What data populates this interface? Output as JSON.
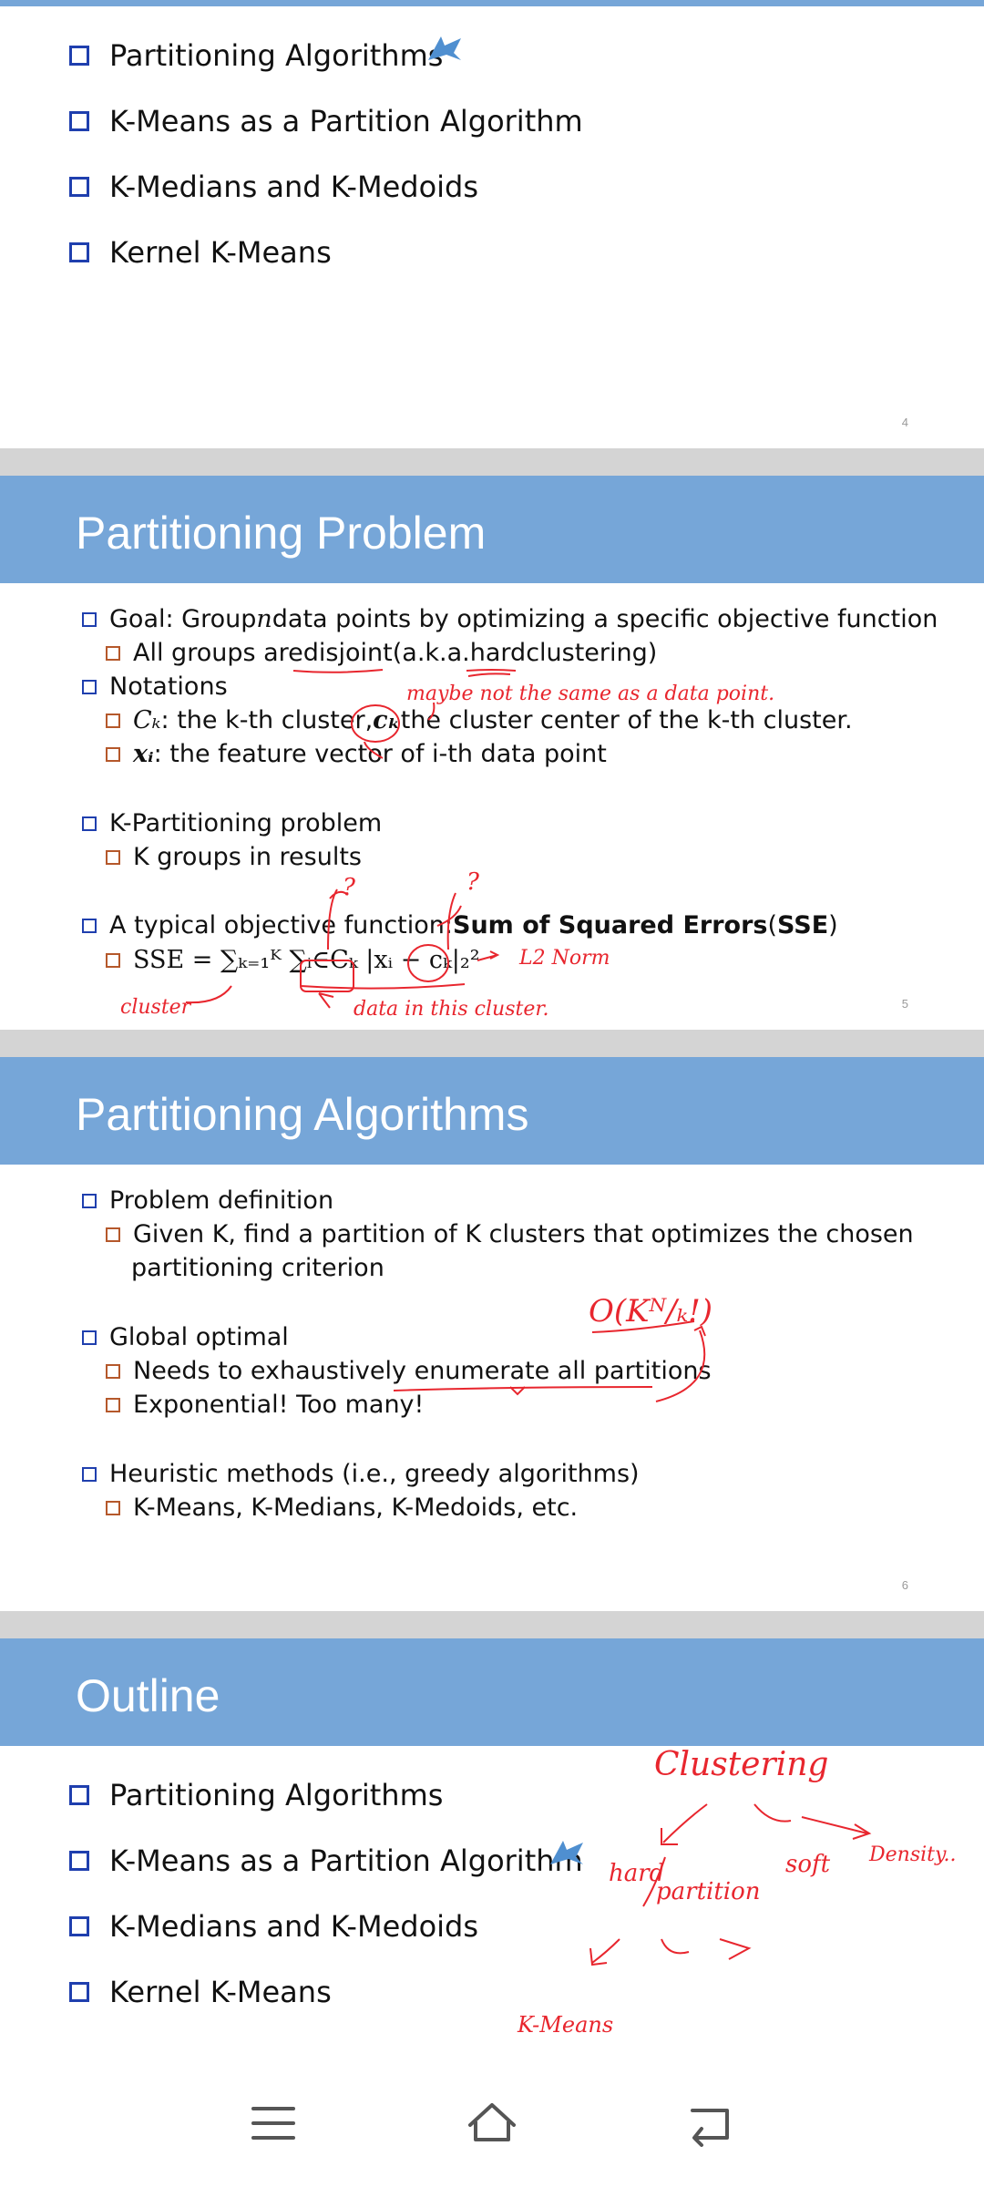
{
  "slides": [
    {
      "page": "4",
      "outline": [
        "Partitioning Algorithms",
        "K-Means as a Partition Algorithm",
        "K-Medians and K-Medoids",
        "Kernel K-Means"
      ]
    },
    {
      "title": "Partitioning Problem",
      "page": "5",
      "goal_pre": "Goal: Group ",
      "goal_n": "n",
      "goal_post": " data points by optimizing a specific objective function",
      "disjoint_pre": "All groups are ",
      "disjoint_word": "disjoint",
      "disjoint_mid": " (a.k.a. ",
      "hard_word": "hard",
      "disjoint_post": " clustering)",
      "notations": "Notations",
      "ck_sym": "Cₖ",
      "ck_text": ": the k-th cluster, ",
      "ck_center_sym": "cₖ",
      "ck_center_text": " the cluster center of the k-th cluster.",
      "xi_sym": "xᵢ",
      "xi_text": ": the feature vector of i-th data point",
      "kpart": "K-Partitioning problem",
      "kgroups": "K groups in results",
      "obj_pre": "A typical objective function: ",
      "obj_bold": "Sum of Squared Errors",
      "obj_mid": " (",
      "obj_sse": "SSE",
      "obj_post": ")",
      "formula": "SSE = ∑ₖ₌₁ᴷ ∑ᵢ∈Cₖ |xᵢ − cₖ|₂²"
    },
    {
      "title": "Partitioning Algorithms",
      "page": "6",
      "b1": "Problem definition",
      "b1a_line1": "Given K, find a partition of K clusters that optimizes the chosen",
      "b1a_line2": "partitioning criterion",
      "b2": "Global optimal",
      "b2a": "Needs to exhaustively enumerate all partitions",
      "b2b": "Exponential! Too many!",
      "b3": "Heuristic methods (i.e., greedy algorithms)",
      "b3a": "K-Means, K-Medians, K-Medoids, etc."
    },
    {
      "title": "Outline",
      "outline": [
        "Partitioning Algorithms",
        "K-Means as a Partition Algorithm",
        "K-Medians and K-Medoids",
        "Kernel K-Means"
      ]
    }
  ],
  "handwriting": {
    "maybe": "maybe not the same as a data point.",
    "q": "?",
    "l2": "L2 Norm",
    "cluster": "cluster",
    "data_in": "data in this cluster.",
    "bigo": "O(Kᴺ/ₖ!)",
    "clustering": "Clustering",
    "hard": "hard",
    "partition": "partition",
    "soft": "soft",
    "density": "Density..",
    "kmeans": "K-Means"
  },
  "nav": {
    "menu": "menu-icon",
    "home": "home-icon",
    "back": "back-icon"
  },
  "colors": {
    "banner": "#76a6d8",
    "ink": "#e8262e",
    "bullet": "#1f3fae",
    "sub_bullet": "#b5582b"
  }
}
